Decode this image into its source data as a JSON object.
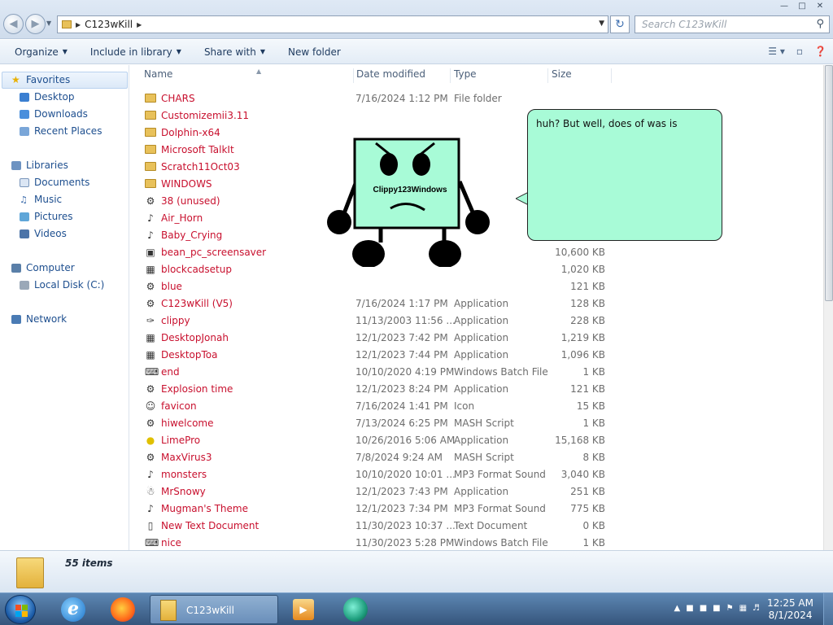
{
  "address": {
    "crumb": "C123wKill",
    "search_placeholder": "Search C123wKill"
  },
  "toolbar": {
    "organize": "Organize",
    "include": "Include in library",
    "share": "Share with",
    "new_folder": "New folder"
  },
  "nav": {
    "favorites": "Favorites",
    "fav_items": [
      "Desktop",
      "Downloads",
      "Recent Places"
    ],
    "libraries": "Libraries",
    "lib_items": [
      "Documents",
      "Music",
      "Pictures",
      "Videos"
    ],
    "computer": "Computer",
    "comp_items": [
      "Local Disk (C:)"
    ],
    "network": "Network"
  },
  "columns": {
    "name": "Name",
    "date": "Date modified",
    "type": "Type",
    "size": "Size"
  },
  "files": [
    {
      "name": "CHARS",
      "date": "7/16/2024 1:12 PM",
      "type": "File folder",
      "size": "",
      "icon": "folder"
    },
    {
      "name": "Customizemii3.11",
      "date": "",
      "type": "",
      "size": "",
      "icon": "folder"
    },
    {
      "name": "Dolphin-x64",
      "date": "",
      "type": "",
      "size": "",
      "icon": "folder"
    },
    {
      "name": "Microsoft TalkIt",
      "date": "",
      "type": "",
      "size": "",
      "icon": "folder"
    },
    {
      "name": "Scratch11Oct03",
      "date": "",
      "type": "",
      "size": "",
      "icon": "folder"
    },
    {
      "name": "WINDOWS",
      "date": "",
      "type": "",
      "size": "",
      "icon": "folder"
    },
    {
      "name": "38 (unused)",
      "date": "",
      "type": "",
      "size": "",
      "icon": "app"
    },
    {
      "name": "Air_Horn",
      "date": "",
      "type": "",
      "size": "",
      "icon": "audio"
    },
    {
      "name": "Baby_Crying",
      "date": "",
      "type": "",
      "size": "",
      "icon": "audio"
    },
    {
      "name": "bean_pc_screensaver",
      "date": "",
      "type": "",
      "size": "10,600 KB",
      "icon": "screensaver"
    },
    {
      "name": "blockcadsetup",
      "date": "",
      "type": "",
      "size": "1,020 KB",
      "icon": "setup"
    },
    {
      "name": "blue",
      "date": "",
      "type": "",
      "size": "121 KB",
      "icon": "app"
    },
    {
      "name": "C123wKill (V5)",
      "date": "7/16/2024 1:17 PM",
      "type": "Application",
      "size": "128 KB",
      "icon": "app"
    },
    {
      "name": "clippy",
      "date": "11/13/2003 11:56 ...",
      "type": "Application",
      "size": "228 KB",
      "icon": "paperclip"
    },
    {
      "name": "DesktopJonah",
      "date": "12/1/2023 7:42 PM",
      "type": "Application",
      "size": "1,219 KB",
      "icon": "setup"
    },
    {
      "name": "DesktopToa",
      "date": "12/1/2023 7:44 PM",
      "type": "Application",
      "size": "1,096 KB",
      "icon": "setup"
    },
    {
      "name": "end",
      "date": "10/10/2020 4:19 PM",
      "type": "Windows Batch File",
      "size": "1 KB",
      "icon": "batch"
    },
    {
      "name": "Explosion time",
      "date": "12/1/2023 8:24 PM",
      "type": "Application",
      "size": "121 KB",
      "icon": "app"
    },
    {
      "name": "favicon",
      "date": "7/16/2024 1:41 PM",
      "type": "Icon",
      "size": "15 KB",
      "icon": "favicon"
    },
    {
      "name": "hiwelcome",
      "date": "7/13/2024 6:25 PM",
      "type": "MASH Script",
      "size": "1 KB",
      "icon": "app"
    },
    {
      "name": "LimePro",
      "date": "10/26/2016 5:06 AM",
      "type": "Application",
      "size": "15,168 KB",
      "icon": "lime"
    },
    {
      "name": "MaxVirus3",
      "date": "7/8/2024 9:24 AM",
      "type": "MASH Script",
      "size": "8 KB",
      "icon": "app"
    },
    {
      "name": "monsters",
      "date": "10/10/2020 10:01 ...",
      "type": "MP3 Format Sound",
      "size": "3,040 KB",
      "icon": "audio"
    },
    {
      "name": "MrSnowy",
      "date": "12/1/2023 7:43 PM",
      "type": "Application",
      "size": "251 KB",
      "icon": "snowman"
    },
    {
      "name": "Mugman's Theme",
      "date": "12/1/2023 7:34 PM",
      "type": "MP3 Format Sound",
      "size": "775 KB",
      "icon": "audio"
    },
    {
      "name": "New Text Document",
      "date": "11/30/2023 10:37 ...",
      "type": "Text Document",
      "size": "0 KB",
      "icon": "text"
    },
    {
      "name": "nice",
      "date": "11/30/2023 5:28 PM",
      "type": "Windows Batch File",
      "size": "1 KB",
      "icon": "batch"
    }
  ],
  "status": {
    "count": "55 items"
  },
  "clippy": {
    "label": "Clippy123Windows",
    "speech": "huh? But well, does of was is",
    "bubble_color": "#a8fbd7",
    "body_color": "#a8fbd7"
  },
  "taskbar": {
    "explorer_label": "C123wKill",
    "time": "12:25 AM",
    "date": "8/1/2024"
  }
}
